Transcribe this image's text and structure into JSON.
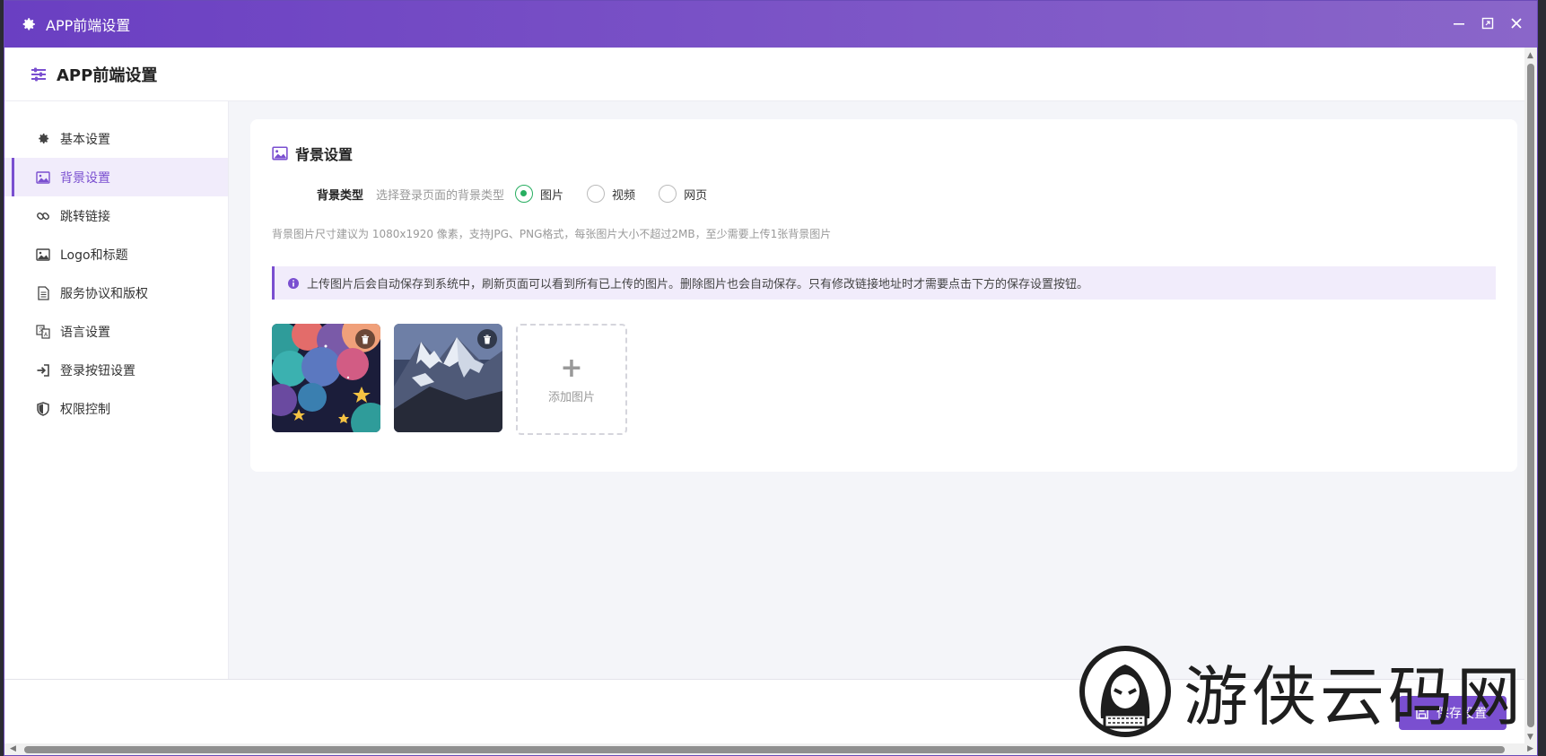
{
  "window": {
    "title": "APP前端设置",
    "controls": [
      "minimize",
      "maximize",
      "close"
    ]
  },
  "header": {
    "title": "APP前端设置"
  },
  "sidebar": {
    "items": [
      {
        "label": "基本设置",
        "icon": "gear-icon",
        "active": false
      },
      {
        "label": "背景设置",
        "icon": "image-icon",
        "active": true
      },
      {
        "label": "跳转链接",
        "icon": "link-icon",
        "active": false
      },
      {
        "label": "Logo和标题",
        "icon": "image-icon",
        "active": false
      },
      {
        "label": "服务协议和版权",
        "icon": "document-icon",
        "active": false
      },
      {
        "label": "语言设置",
        "icon": "translate-icon",
        "active": false
      },
      {
        "label": "登录按钮设置",
        "icon": "sign-in-icon",
        "active": false
      },
      {
        "label": "权限控制",
        "icon": "shield-icon",
        "active": false
      }
    ]
  },
  "card": {
    "title": "背景设置",
    "bg_type_label": "背景类型",
    "bg_type_hint": "选择登录页面的背景类型",
    "options": [
      {
        "label": "图片",
        "checked": true
      },
      {
        "label": "视频",
        "checked": false
      },
      {
        "label": "网页",
        "checked": false
      }
    ],
    "size_hint": "背景图片尺寸建议为 1080x1920 像素，支持JPG、PNG格式，每张图片大小不超过2MB，至少需要上传1张背景图片",
    "info": "上传图片后会自动保存到系统中，刷新页面可以看到所有已上传的图片。删除图片也会自动保存。只有修改链接地址时才需要点击下方的保存设置按钮。",
    "add_image_label": "添加图片"
  },
  "footer": {
    "save_label": "保存设置"
  },
  "watermark": {
    "text": "游侠云码网"
  },
  "colors": {
    "accent": "#7a4fd0",
    "radio_checked": "#27ae60",
    "title_bar": "#6a3fc2"
  }
}
